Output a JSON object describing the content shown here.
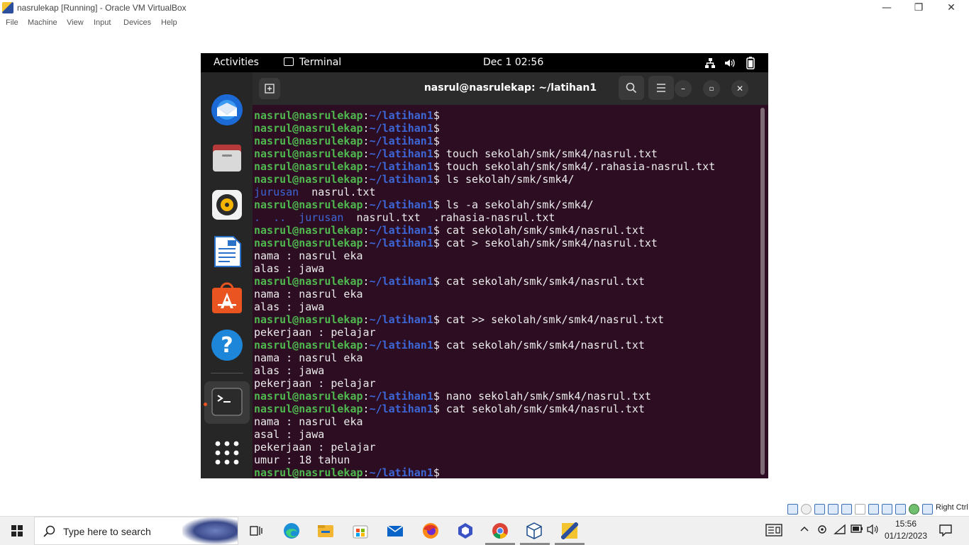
{
  "vbox": {
    "title": "nasrulekap [Running] - Oracle VM VirtualBox",
    "menu": [
      "File",
      "Machine",
      "View",
      "Input",
      "Devices",
      "Help"
    ],
    "controls": {
      "minimize": "—",
      "restore": "❐",
      "close": "✕"
    },
    "status_host_key": "Right Ctrl"
  },
  "gnome": {
    "activities": "Activities",
    "app_name": "Terminal",
    "clock": "Dec 1  02:56"
  },
  "dock": {
    "items": [
      "thunderbird-icon",
      "files-icon",
      "rhythmbox-icon",
      "libreoffice-writer-icon",
      "app-center-icon",
      "help-icon",
      "terminal-icon",
      "show-apps-icon"
    ]
  },
  "terminal": {
    "title": "nasrul@nasrulekap: ~/latihan1",
    "prompt_user": "nasrul@nasrulekap",
    "prompt_sep": ":",
    "prompt_path": "~/latihan1",
    "prompt_dollar": "$",
    "lines": [
      {
        "type": "prompt",
        "cmd": ""
      },
      {
        "type": "prompt",
        "cmd": ""
      },
      {
        "type": "prompt",
        "cmd": ""
      },
      {
        "type": "prompt",
        "cmd": " touch sekolah/smk/smk4/nasrul.txt"
      },
      {
        "type": "prompt",
        "cmd": " touch sekolah/smk/smk4/.rahasia-nasrul.txt"
      },
      {
        "type": "prompt",
        "cmd": " ls sekolah/smk/smk4/"
      },
      {
        "type": "ls",
        "parts": [
          {
            "t": "jurusan",
            "c": "d"
          },
          {
            "t": "  nasrul.txt",
            "c": ""
          }
        ]
      },
      {
        "type": "prompt",
        "cmd": " ls -a sekolah/smk/smk4/"
      },
      {
        "type": "ls",
        "parts": [
          {
            "t": ".  ..  jurusan",
            "c": "d"
          },
          {
            "t": "  nasrul.txt  .rahasia-nasrul.txt",
            "c": ""
          }
        ]
      },
      {
        "type": "prompt",
        "cmd": " cat sekolah/smk/smk4/nasrul.txt"
      },
      {
        "type": "prompt",
        "cmd": " cat > sekolah/smk/smk4/nasrul.txt"
      },
      {
        "type": "out",
        "text": "nama : nasrul eka"
      },
      {
        "type": "out",
        "text": "alas : jawa"
      },
      {
        "type": "prompt",
        "cmd": " cat sekolah/smk/smk4/nasrul.txt"
      },
      {
        "type": "out",
        "text": "nama : nasrul eka"
      },
      {
        "type": "out",
        "text": "alas : jawa"
      },
      {
        "type": "prompt",
        "cmd": " cat >> sekolah/smk/smk4/nasrul.txt"
      },
      {
        "type": "out",
        "text": "pekerjaan : pelajar"
      },
      {
        "type": "prompt",
        "cmd": " cat sekolah/smk/smk4/nasrul.txt"
      },
      {
        "type": "out",
        "text": "nama : nasrul eka"
      },
      {
        "type": "out",
        "text": "alas : jawa"
      },
      {
        "type": "out",
        "text": "pekerjaan : pelajar"
      },
      {
        "type": "prompt",
        "cmd": " nano sekolah/smk/smk4/nasrul.txt"
      },
      {
        "type": "prompt",
        "cmd": " cat sekolah/smk/smk4/nasrul.txt"
      },
      {
        "type": "out",
        "text": "nama : nasrul eka"
      },
      {
        "type": "out",
        "text": "asal : jawa"
      },
      {
        "type": "out",
        "text": "pekerjaan : pelajar"
      },
      {
        "type": "out",
        "text": "umur : 18 tahun"
      },
      {
        "type": "prompt",
        "cmd": ""
      }
    ]
  },
  "windows": {
    "search_placeholder": "Type here to search",
    "time": "15:56",
    "date": "01/12/2023",
    "taskbar_apps": [
      "task-view-icon",
      "edge-icon",
      "file-explorer-icon",
      "store-icon",
      "mail-icon",
      "firefox-icon",
      "copilot-icon",
      "chrome-icon",
      "virtualbox-icon",
      "vm-window-icon"
    ]
  }
}
